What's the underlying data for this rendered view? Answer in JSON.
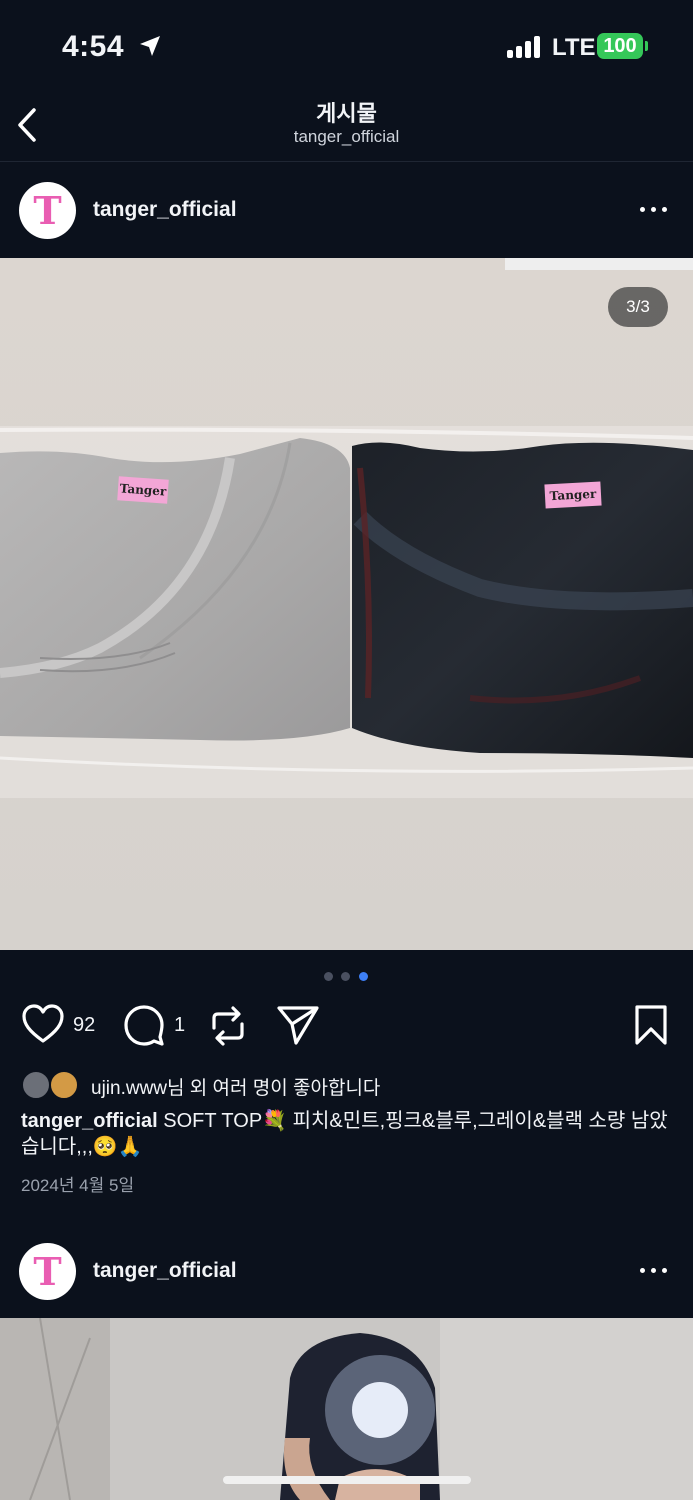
{
  "status_bar": {
    "time": "4:54",
    "network": "LTE",
    "battery": "100"
  },
  "nav": {
    "title": "게시물",
    "subtitle": "tanger_official"
  },
  "post": {
    "username": "tanger_official",
    "avatar_letter": "T",
    "image_counter": "3/3",
    "image_labels": [
      "Tanger",
      "Tanger"
    ],
    "like_count": "92",
    "comment_count": "1",
    "liked_by": "ujin.www님 외 여러 명이 좋아합니다",
    "caption_user": "tanger_official",
    "caption_text": " SOFT TOP💐 피치&민트,핑크&블루,그레이&블랙 소량 남았습니다,,,🥺🙏",
    "date": "2024년 4월 5일",
    "carousel_dots": 3,
    "active_dot": 2
  },
  "next_post": {
    "username": "tanger_official",
    "avatar_letter": "T"
  },
  "colors": {
    "background": "#0b111c",
    "accent": "#3d7ff5",
    "battery": "#35c759",
    "brand_pink": "#e95db2"
  }
}
